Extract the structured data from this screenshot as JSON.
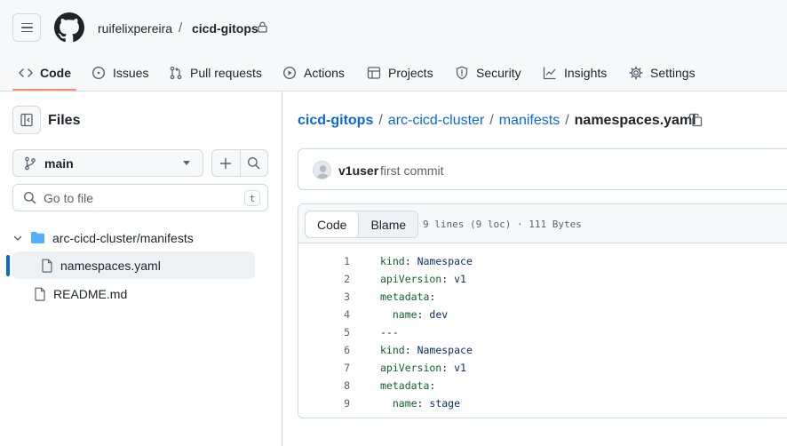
{
  "repo": {
    "owner": "ruifelixpereira",
    "separator": "/",
    "name": "cicd-gitops"
  },
  "nav": [
    {
      "label": "Code",
      "icon": "code-icon",
      "active": true
    },
    {
      "label": "Issues",
      "icon": "issue-opened-icon"
    },
    {
      "label": "Pull requests",
      "icon": "git-pull-request-icon"
    },
    {
      "label": "Actions",
      "icon": "play-icon"
    },
    {
      "label": "Projects",
      "icon": "table-icon"
    },
    {
      "label": "Security",
      "icon": "shield-icon"
    },
    {
      "label": "Insights",
      "icon": "graph-icon"
    },
    {
      "label": "Settings",
      "icon": "gear-icon"
    }
  ],
  "sidebar": {
    "title": "Files",
    "branch": "main",
    "goto_placeholder": "Go to file",
    "goto_shortcut": "t",
    "tree": [
      {
        "label": "arc-cicd-cluster/manifests",
        "type": "folder",
        "expanded": true
      },
      {
        "label": "namespaces.yaml",
        "type": "file",
        "selected": true
      },
      {
        "label": "README.md",
        "type": "file"
      }
    ]
  },
  "path": {
    "parts": [
      "cicd-gitops",
      "arc-cicd-cluster",
      "manifests"
    ],
    "separator": "/",
    "current": "namespaces.yaml"
  },
  "commit": {
    "user": "v1user",
    "message": "first commit"
  },
  "code_view": {
    "tabs": [
      "Code",
      "Blame"
    ],
    "meta": "9 lines (9 loc) · 111 Bytes",
    "lines": [
      {
        "n": "1",
        "key": "kind",
        "sep": ": ",
        "value": "Namespace"
      },
      {
        "n": "2",
        "key": "apiVersion",
        "sep": ": ",
        "value": "v1"
      },
      {
        "n": "3",
        "key": "metadata",
        "sep": ":",
        "value": ""
      },
      {
        "n": "4",
        "key": "  name",
        "sep": ": ",
        "value": "dev"
      },
      {
        "n": "5",
        "key": "",
        "sep": "",
        "value": "---",
        "plain": true
      },
      {
        "n": "6",
        "key": "kind",
        "sep": ": ",
        "value": "Namespace"
      },
      {
        "n": "7",
        "key": "apiVersion",
        "sep": ": ",
        "value": "v1"
      },
      {
        "n": "8",
        "key": "metadata",
        "sep": ":",
        "value": ""
      },
      {
        "n": "9",
        "key": "  name",
        "sep": ": ",
        "value": "stage"
      }
    ]
  },
  "colors": {
    "accent": "#0969da",
    "nav_underline": "#fd8c73",
    "yaml_key": "#116329",
    "yaml_value": "#0a3069",
    "folder": "#54aeff"
  }
}
